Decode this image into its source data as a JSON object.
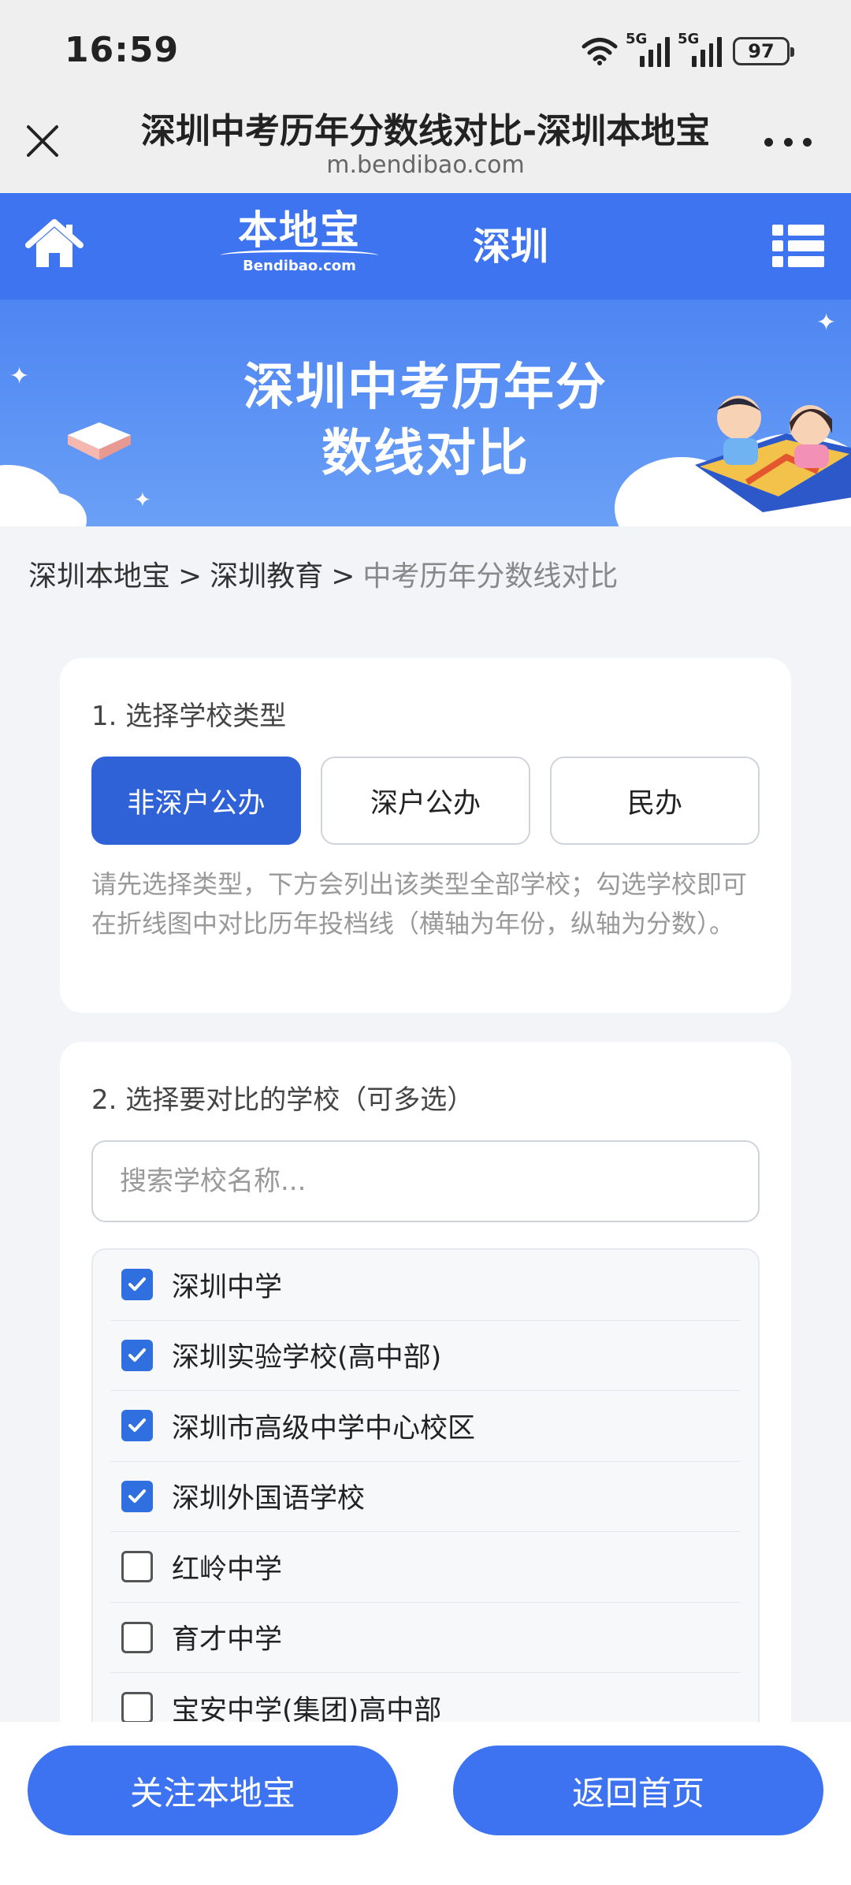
{
  "status_bar": {
    "time": "16:59",
    "network_1": "5G",
    "network_2": "5G",
    "battery": "97"
  },
  "browser": {
    "title": "深圳中考历年分数线对比-深圳本地宝",
    "url": "m.bendibao.com"
  },
  "site_nav": {
    "logo_text": "本地宝",
    "logo_subtext": "Bendibao.com",
    "city": "深圳"
  },
  "banner": {
    "title_line1": "深圳中考历年分",
    "title_line2": "数线对比"
  },
  "breadcrumb": {
    "item1": "深圳本地宝",
    "item2": "深圳教育",
    "current": "中考历年分数线对比",
    "separator": ">"
  },
  "school_type_card": {
    "title": "1. 选择学校类型",
    "options": [
      "非深户公办",
      "深户公办",
      "民办"
    ],
    "selected": "非深户公办",
    "hint": "请先选择类型，下方会列出该类型全部学校；勾选学校即可在折线图中对比历年投档线（横轴为年份，纵轴为分数）。"
  },
  "school_select_card": {
    "title": "2. 选择要对比的学校（可多选）",
    "search_placeholder": "搜索学校名称...",
    "schools": [
      {
        "name": "深圳中学",
        "checked": true
      },
      {
        "name": "深圳实验学校(高中部)",
        "checked": true
      },
      {
        "name": "深圳市高级中学中心校区",
        "checked": true
      },
      {
        "name": "深圳外国语学校",
        "checked": true
      },
      {
        "name": "红岭中学",
        "checked": false
      },
      {
        "name": "育才中学",
        "checked": false
      },
      {
        "name": "宝安中学(集团)高中部",
        "checked": false
      }
    ]
  },
  "bottom_bar": {
    "follow_label": "关注本地宝",
    "home_label": "返回首页"
  },
  "colors": {
    "brand_blue": "#3f74f0",
    "active_button": "#2e62d6",
    "checkbox_checked": "#2f6fe0"
  }
}
